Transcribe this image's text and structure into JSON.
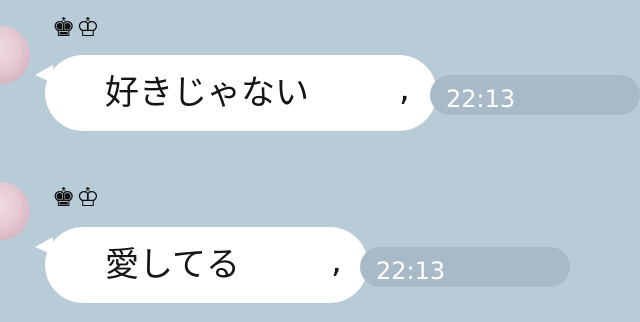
{
  "messages": [
    {
      "sender": "♚♔",
      "text": "好きじゃない",
      "trailing": ",",
      "time": "22:13"
    },
    {
      "sender": "♚♔",
      "text": "愛してる",
      "trailing": ",",
      "time": "22:13"
    }
  ],
  "colors": {
    "background": "#b8ccd8",
    "bubble": "#ffffff",
    "timestamp_pill": "#a8bac7",
    "text": "#151515"
  }
}
